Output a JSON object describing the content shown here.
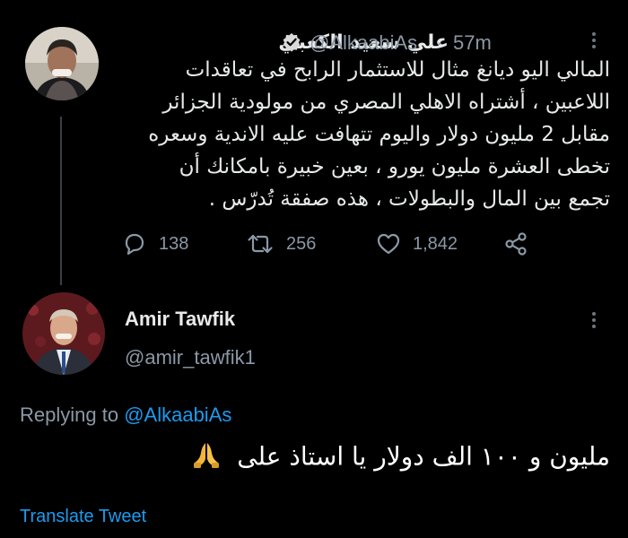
{
  "tweet": {
    "author_name": "علي سعيد الكعبي",
    "handle": "@AlkaabiAs",
    "separator": "·",
    "time": "57m",
    "text": "المالي اليو ديانغ مثال للاستثمار الرابح في تعاقدات اللاعبين ، أشتراه الاهلي المصري من مولودية الجزائر مقابل 2 مليون دولار واليوم تتهافت عليه الاندية وسعره تخطى العشرة مليون يورو ، بعين خبيرة بامكانك أن تجمع بين المال والبطولات ، هذه صفقة تُدرّس .",
    "actions": {
      "replies": "138",
      "retweets": "256",
      "likes": "1,842"
    }
  },
  "reply": {
    "author_name": "Amir Tawfik",
    "handle": "@amir_tawfik1",
    "replying_prefix": "Replying to",
    "replying_handle": "@AlkaabiAs",
    "text": "مليون و ١٠٠ الف دولار يا استاذ على",
    "emoji": "🙏",
    "translate_label": "Translate Tweet"
  },
  "colors": {
    "background": "#000000",
    "accent": "#1d9bf0",
    "muted": "#8b98a5",
    "text": "#e7e9ea"
  },
  "icons": [
    "verified-badge-icon",
    "more-icon",
    "reply-icon",
    "retweet-icon",
    "like-icon",
    "share-icon",
    "pray-emoji-icon"
  ]
}
